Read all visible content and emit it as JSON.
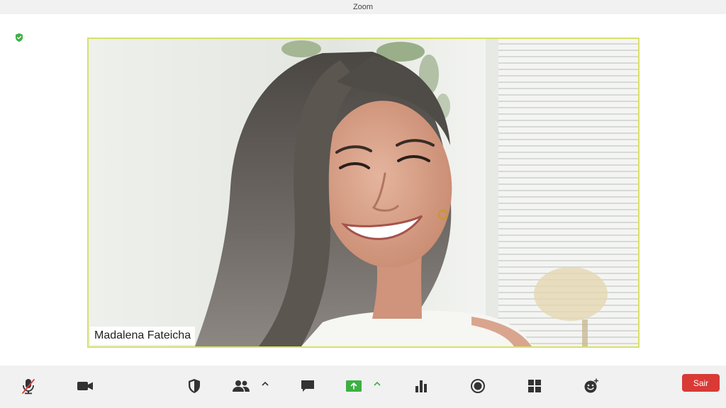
{
  "window": {
    "title": "Zoom"
  },
  "security_status": {
    "icon": "shield-check-icon",
    "color": "#3cb043"
  },
  "video": {
    "participant_name": "Madalena Fateicha",
    "active_speaker_border_color": "#d8e06a"
  },
  "toolbar": {
    "buttons": [
      {
        "id": "mute",
        "icon": "microphone-muted-icon",
        "muted_color": "#e53935"
      },
      {
        "id": "video",
        "icon": "video-camera-icon"
      },
      {
        "id": "security",
        "icon": "shield-icon"
      },
      {
        "id": "participants",
        "icon": "participants-icon"
      },
      {
        "id": "chat",
        "icon": "chat-bubble-icon"
      },
      {
        "id": "share-screen",
        "icon": "share-screen-icon",
        "color": "#3cb043"
      },
      {
        "id": "polls",
        "icon": "bar-chart-icon"
      },
      {
        "id": "record",
        "icon": "record-icon"
      },
      {
        "id": "apps",
        "icon": "apps-grid-icon"
      },
      {
        "id": "reactions",
        "icon": "reaction-emoji-icon"
      }
    ],
    "leave_label": "Sair",
    "leave_color": "#d93a36"
  }
}
